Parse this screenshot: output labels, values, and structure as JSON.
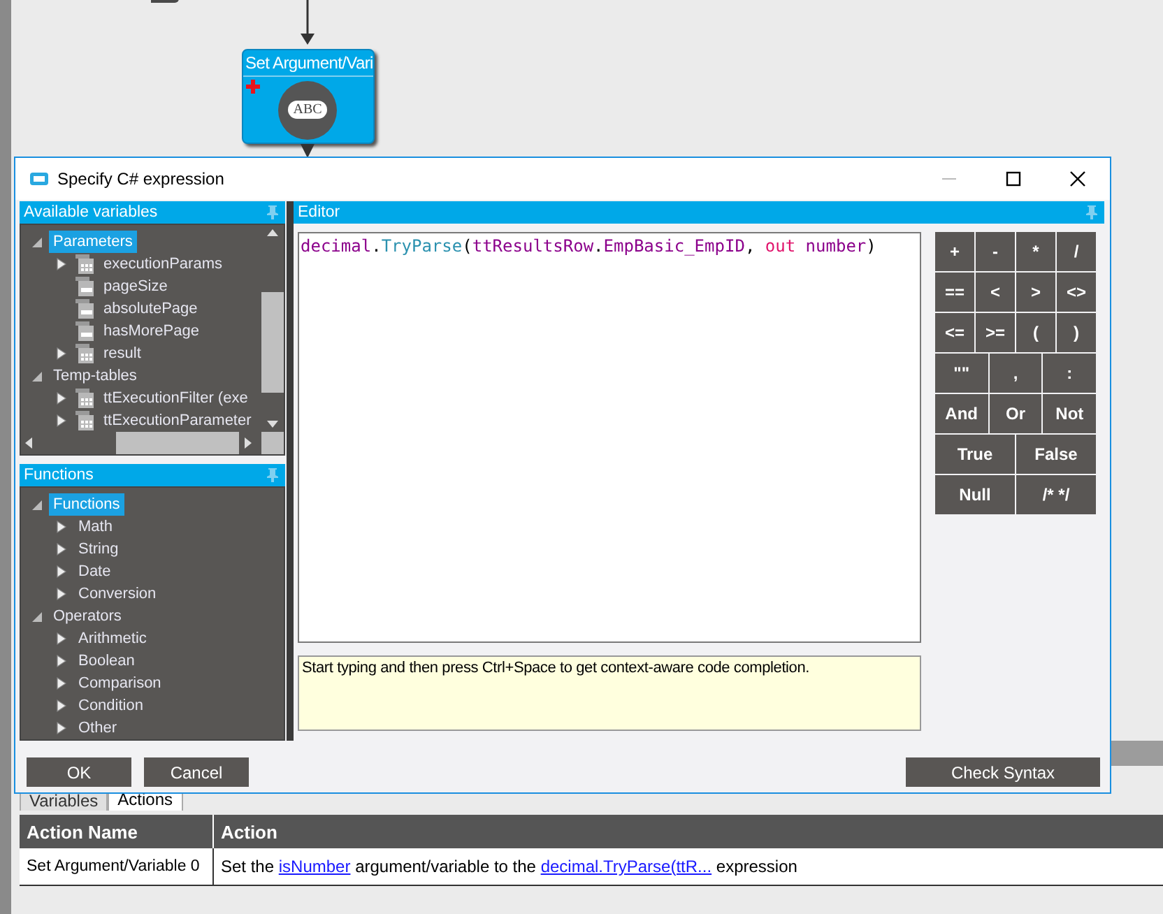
{
  "flow_node": {
    "title": "Set Argument/Vari",
    "icon_label": "ABC"
  },
  "dialog": {
    "title": "Specify C# expression",
    "variables_panel": {
      "title": "Available variables",
      "tree": [
        {
          "label": "Parameters",
          "expanded": true,
          "selected": true,
          "children": [
            {
              "label": "executionParams",
              "kind": "table",
              "expanded": false
            },
            {
              "label": "pageSize",
              "kind": "field"
            },
            {
              "label": "absolutePage",
              "kind": "field"
            },
            {
              "label": "hasMorePage",
              "kind": "field"
            },
            {
              "label": "result",
              "kind": "table",
              "expanded": false
            }
          ]
        },
        {
          "label": "Temp-tables",
          "expanded": true,
          "selected": false,
          "children": [
            {
              "label": "ttExecutionFilter (exe",
              "kind": "table",
              "expanded": false
            },
            {
              "label": "ttExecutionParameter",
              "kind": "table",
              "expanded": false
            }
          ]
        }
      ]
    },
    "functions_panel": {
      "title": "Functions",
      "tree": [
        {
          "label": "Functions",
          "expanded": true,
          "selected": true,
          "children": [
            {
              "label": "Math",
              "expanded": false
            },
            {
              "label": "String",
              "expanded": false
            },
            {
              "label": "Date",
              "expanded": false
            },
            {
              "label": "Conversion",
              "expanded": false
            }
          ]
        },
        {
          "label": "Operators",
          "expanded": true,
          "selected": false,
          "children": [
            {
              "label": "Arithmetic",
              "expanded": false
            },
            {
              "label": "Boolean",
              "expanded": false
            },
            {
              "label": "Comparison",
              "expanded": false
            },
            {
              "label": "Condition",
              "expanded": false
            },
            {
              "label": "Other",
              "expanded": false
            }
          ]
        }
      ]
    },
    "editor": {
      "title": "Editor",
      "code": [
        {
          "text": "decimal",
          "kind": "type"
        },
        {
          "text": ".",
          "kind": "plain"
        },
        {
          "text": "TryParse",
          "kind": "method"
        },
        {
          "text": "(",
          "kind": "plain"
        },
        {
          "text": "ttResultsRow",
          "kind": "identifier"
        },
        {
          "text": ".",
          "kind": "plain"
        },
        {
          "text": "EmpBasic_EmpID",
          "kind": "identifier"
        },
        {
          "text": ", ",
          "kind": "plain"
        },
        {
          "text": "out",
          "kind": "keyword"
        },
        {
          "text": " number",
          "kind": "identifier"
        },
        {
          "text": ")",
          "kind": "plain"
        }
      ],
      "hint": "Start typing and then press Ctrl+Space to get context-aware code completion."
    },
    "keypad": [
      [
        "+",
        "-",
        "*",
        "/"
      ],
      [
        "==",
        "<",
        ">",
        "<>"
      ],
      [
        "<=",
        ">=",
        "(",
        ")"
      ],
      [
        "\"\"",
        ",",
        ":"
      ],
      [
        "And",
        "Or",
        "Not"
      ],
      [
        "True",
        "False"
      ],
      [
        "Null",
        "/* */"
      ]
    ],
    "buttons": {
      "ok": "OK",
      "cancel": "Cancel",
      "check": "Check Syntax"
    }
  },
  "tabs": [
    {
      "label": "Variables",
      "selected": false
    },
    {
      "label": "Actions",
      "selected": true
    }
  ],
  "table": {
    "columns": [
      "Action Name",
      "Action"
    ],
    "rows": [
      {
        "name": "Set Argument/Variable 0",
        "action": [
          {
            "kind": "text",
            "text": "Set the "
          },
          {
            "kind": "link",
            "text": "isNumber"
          },
          {
            "kind": "text",
            "text": " argument/variable to the "
          },
          {
            "kind": "link",
            "text": "decimal.TryParse(ttR..."
          },
          {
            "kind": "text",
            "text": " expression"
          }
        ]
      }
    ]
  }
}
